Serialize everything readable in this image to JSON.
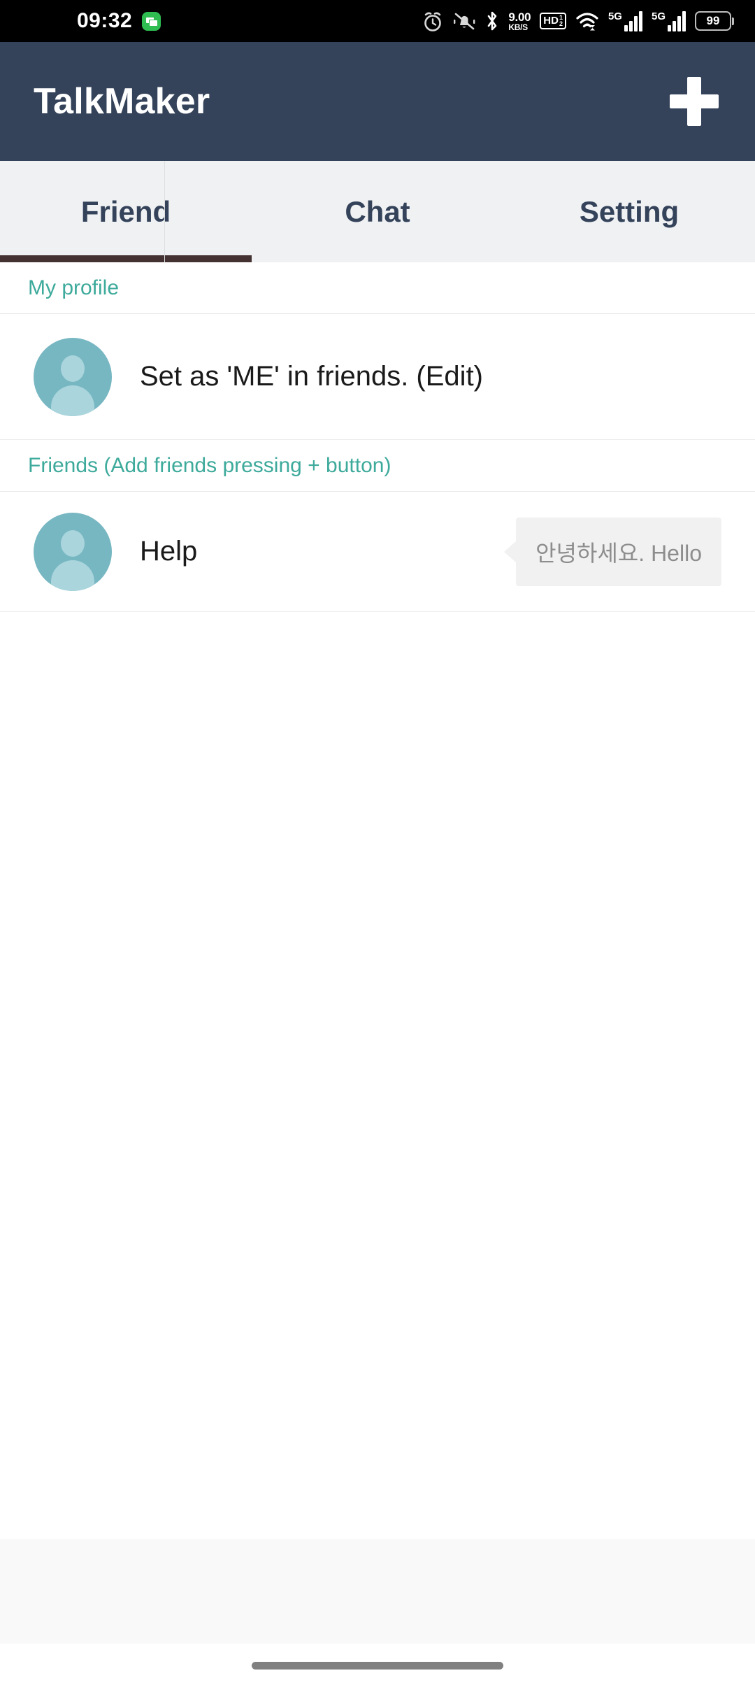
{
  "status_bar": {
    "time": "09:32",
    "message_icon": "chat-bubble-icon",
    "alarm_icon": "alarm-clock-icon",
    "mute_icon": "bell-muted-icon",
    "bluetooth_icon": "bluetooth-icon",
    "network_speed_value": "9.00",
    "network_speed_unit": "KB/S",
    "hd_label": "HD",
    "hd_sup": "1",
    "hd_sub": "2",
    "wifi_icon": "wifi-icon",
    "sim1_label": "5G",
    "sim2_label": "5G",
    "battery_percent": "99"
  },
  "app_bar": {
    "title": "TalkMaker",
    "add_button_label": "+"
  },
  "tabs": [
    {
      "label": "Friend",
      "active": true
    },
    {
      "label": "Chat",
      "active": false
    },
    {
      "label": "Setting",
      "active": false
    }
  ],
  "sections": {
    "my_profile": {
      "header": "My profile",
      "row_label": "Set as 'ME' in friends. (Edit)"
    },
    "friends": {
      "header": "Friends (Add friends pressing + button)",
      "items": [
        {
          "name": "Help",
          "message": "안녕하세요. Hello"
        }
      ]
    }
  },
  "colors": {
    "app_bar_bg": "#34435a",
    "tab_bar_bg": "#f0f1f3",
    "tab_text": "#34435a",
    "tab_indicator": "#443233",
    "section_header_text": "#3daa9b",
    "avatar_bg": "#77b7c2",
    "avatar_glyph": "#aad5dd",
    "bubble_bg": "#f1f1f1",
    "bubble_text": "#8d8d8d",
    "status_bar_bg": "#000000",
    "ad_band_bg": "#f9f9f9"
  }
}
